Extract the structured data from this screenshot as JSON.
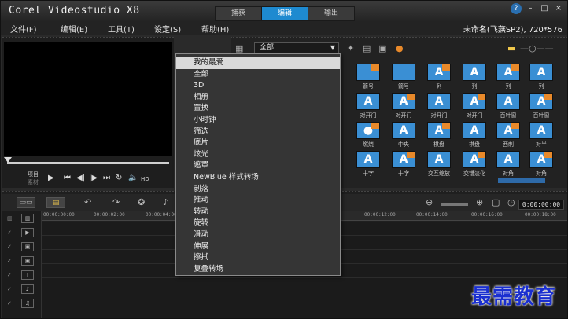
{
  "app": {
    "title": "Corel Videostudio X8"
  },
  "mode_tabs": [
    {
      "label": "捕获"
    },
    {
      "label": "编辑",
      "active": true
    },
    {
      "label": "输出"
    }
  ],
  "window_controls": {
    "help": "?",
    "minimize": "–",
    "maximize": "□",
    "close": "×"
  },
  "menu": [
    {
      "label": "文件(F)"
    },
    {
      "label": "编辑(E)"
    },
    {
      "label": "工具(T)"
    },
    {
      "label": "设定(S)"
    },
    {
      "label": "帮助(H)"
    }
  ],
  "project_info": "未命名(飞燕SP2), 720*576",
  "preview": {
    "project_label": "项目",
    "clip_label": "素材",
    "hd_label": "HD"
  },
  "library": {
    "category_value": "全部",
    "labels": {
      "row1": [
        "箭号",
        "箭号",
        "列",
        "列",
        "列",
        "列"
      ],
      "row2": [
        "对开门",
        "对开门",
        "对开门",
        "对开门",
        "百叶窗",
        "百叶窗"
      ],
      "row3": [
        "燃烧",
        "中央",
        "棋盘",
        "棋盘",
        "西刺",
        "对半"
      ],
      "row4": [
        "十字",
        "十字",
        "交互缩放",
        "交错淡化",
        "对角",
        "对角"
      ]
    }
  },
  "dropdown": {
    "items": [
      "我的最爱",
      "全部",
      "3D",
      "相册",
      "置换",
      "小时钟",
      "筛选",
      "底片",
      "炫光",
      "遮罩",
      "NewBlue 样式转场",
      "剥落",
      "推动",
      "转动",
      "旋转",
      "滑动",
      "伸展",
      "擦拭",
      "复叠转场"
    ],
    "selected_index": 0
  },
  "timeline": {
    "timecode": "0:00:00:00",
    "ruler_ticks": [
      "00:00:00:00",
      "00:00:02:00",
      "00:00:04:00",
      "00:00:12:00",
      "00:00:14:00",
      "00:00:16:00",
      "00:00:18:00"
    ]
  },
  "watermark": "最需教育",
  "colors": {
    "accent": "#1e8ad0",
    "thumb": "#3a8fd4",
    "thumb_corner": "#e8892a",
    "watermark": "#1a2fd0"
  }
}
